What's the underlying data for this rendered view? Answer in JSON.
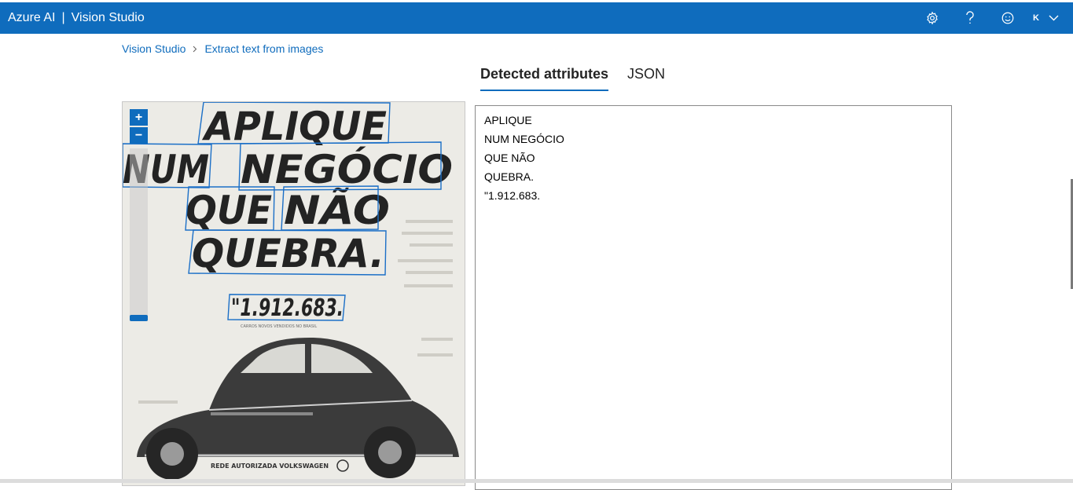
{
  "header": {
    "brand": "Azure AI",
    "separator": "|",
    "product": "Vision Studio",
    "account_initial": "K",
    "icons": [
      "gear-icon",
      "help-icon",
      "feedback-smiley-icon",
      "chevron-down-icon"
    ]
  },
  "breadcrumb": {
    "items": [
      "Vision Studio",
      "Extract text from images"
    ]
  },
  "tabs": [
    {
      "label": "Detected attributes",
      "active": true
    },
    {
      "label": "JSON",
      "active": false
    }
  ],
  "image_viewer": {
    "zoom_in_label": "+",
    "zoom_out_label": "−",
    "zoom_level": 0.0,
    "ad_words": [
      "APLIQUE",
      "NUM",
      "NEGÓCIO",
      "QUE",
      "NÃO",
      "QUEBRA.",
      "\"1.912.683."
    ],
    "ad_small_caption": "CARROS NOVOS VENDIDOS NO BRASIL",
    "ad_footer": "REDE AUTORIZADA VOLKSWAGEN"
  },
  "detected_text": {
    "lines": [
      "APLIQUE",
      "NUM NEGÓCIO",
      "QUE NÃO",
      "QUEBRA.",
      "\"1.912.683."
    ]
  },
  "colors": {
    "accent": "#0f6cbd",
    "header_text": "#ffffff",
    "body_text": "#242424"
  }
}
